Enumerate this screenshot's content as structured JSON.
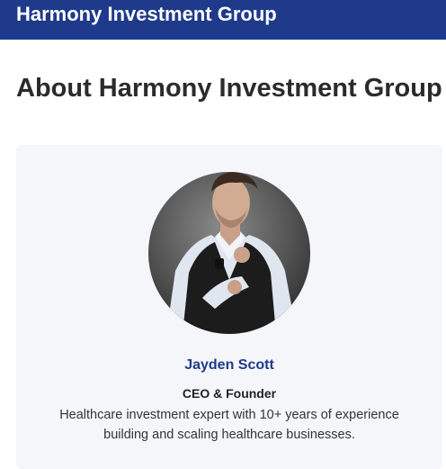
{
  "header": {
    "brand": "Harmony Investment Group"
  },
  "main": {
    "title": "About Harmony Investment Group"
  },
  "team_card": {
    "name": "Jayden Scott",
    "role": "CEO & Founder",
    "bio": "Healthcare investment expert with 10+ years of experience building and scaling healthcare businesses."
  },
  "colors": {
    "header_bg": "#1f3a8a",
    "accent": "#1f3a8a",
    "card_bg": "#f5f6fa"
  }
}
